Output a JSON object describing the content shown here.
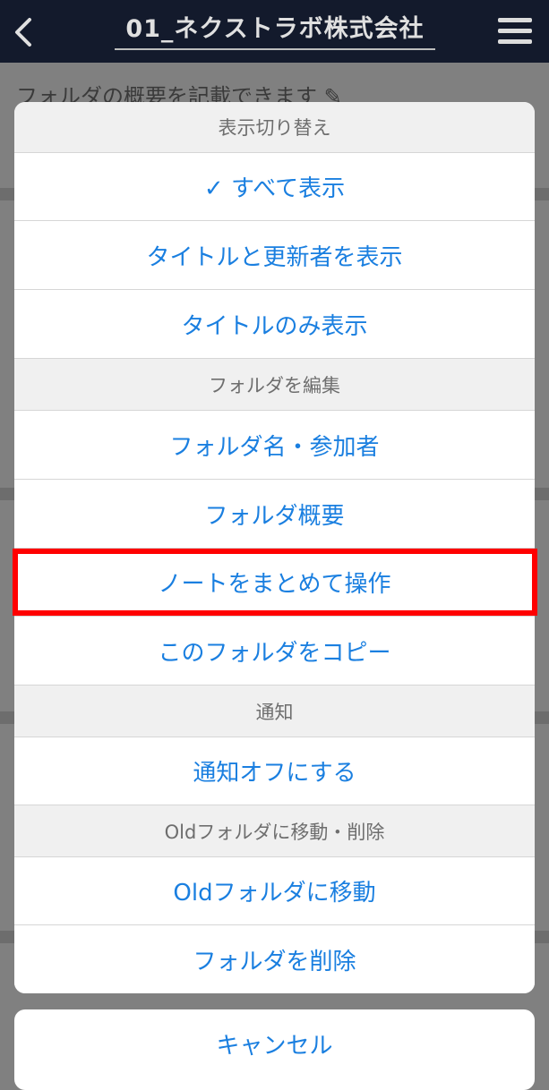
{
  "navbar": {
    "title": "01_ネクストラボ株式会社",
    "back_icon": "chevron-left-icon",
    "menu_icon": "hamburger-menu-icon"
  },
  "background": {
    "description_text": "フォルダの概要を記載できます ✎"
  },
  "action_sheet": {
    "section_display": "表示切り替え",
    "show_all": "✓ すべて表示",
    "show_title_updater": "タイトルと更新者を表示",
    "show_title_only": "タイトルのみ表示",
    "section_edit": "フォルダを編集",
    "folder_name_members": "フォルダ名・参加者",
    "folder_overview": "フォルダ概要",
    "bulk_note_ops": "ノートをまとめて操作",
    "copy_folder": "このフォルダをコピー",
    "section_notify": "通知",
    "notify_off": "通知オフにする",
    "section_old": "Oldフォルダに移動・削除",
    "move_old": "Oldフォルダに移動",
    "delete_folder": "フォルダを削除"
  },
  "cancel": "キャンセル",
  "colors": {
    "accent": "#1a7fe0",
    "highlight": "#ff0000",
    "navbar": "#131a2c"
  }
}
